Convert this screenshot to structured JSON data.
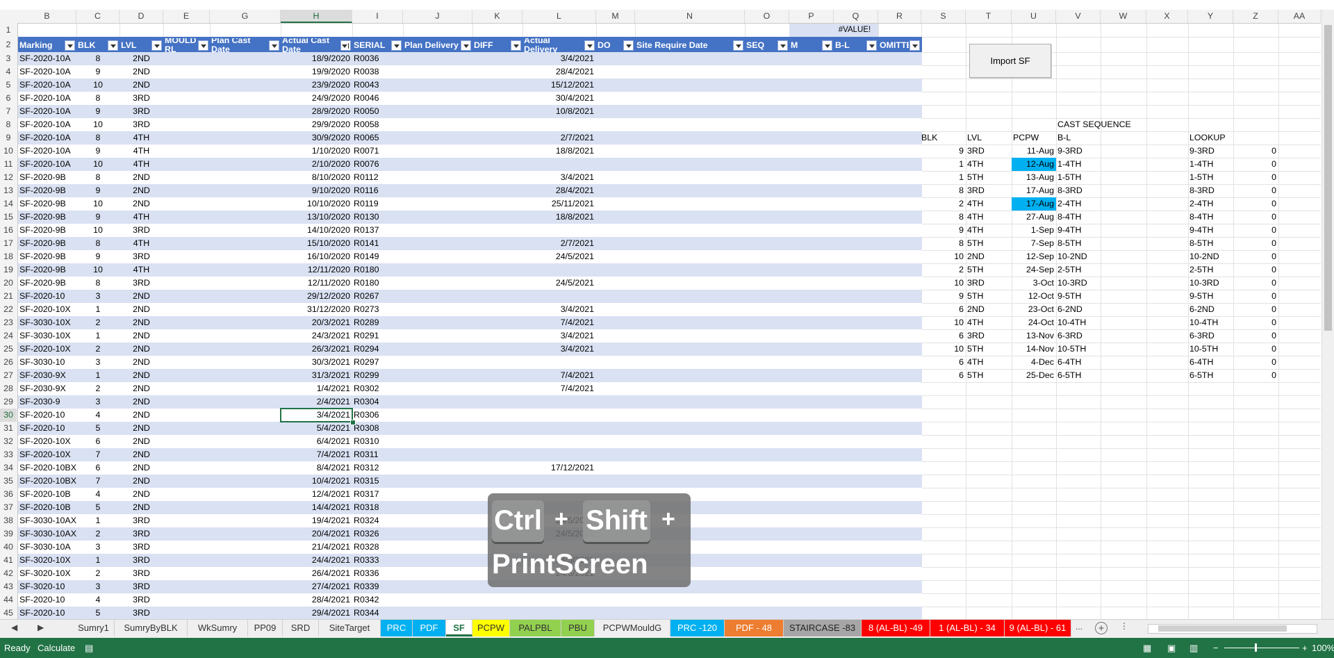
{
  "columns": [
    "B",
    "C",
    "D",
    "E",
    "G",
    "H",
    "I",
    "J",
    "K",
    "L",
    "M",
    "N",
    "O",
    "P",
    "Q",
    "R",
    "S",
    "T",
    "U",
    "V",
    "W",
    "X",
    "Y",
    "Z",
    "AA"
  ],
  "selected_column": "H",
  "row_numbers": [
    "1",
    "2",
    "3",
    "4",
    "5",
    "6",
    "7",
    "8",
    "9",
    "10",
    "11",
    "12",
    "13",
    "14",
    "15",
    "16",
    "17",
    "18",
    "19",
    "20",
    "21",
    "22",
    "23",
    "24",
    "25",
    "26",
    "27",
    "28",
    "29",
    "30",
    "31",
    "32",
    "33",
    "34",
    "35",
    "36",
    "37",
    "38",
    "39",
    "40",
    "41",
    "42",
    "43",
    "44",
    "45"
  ],
  "selected_row": "30",
  "error_cell": "#VALUE!",
  "table": {
    "headers": [
      "Marking",
      "BLK",
      "LVL",
      "MOULD RL",
      "Plan Cast Date",
      "Actual Cast Date",
      "SERIAL",
      "Plan Delivery",
      "DIFF",
      "Actual Delivery",
      "DO",
      "Site Require Date",
      "SEQ",
      "M",
      "B-L",
      "OMITTED"
    ],
    "header_colors": {
      "header_bg": "#4472c4",
      "band_bg": "#d9e1f2",
      "white_bg": "#ffffff"
    },
    "rows": [
      [
        "SF-2020-10A",
        "8",
        "2ND",
        "18/9/2020",
        "R0036",
        "3/4/2021"
      ],
      [
        "SF-2020-10A",
        "9",
        "2ND",
        "19/9/2020",
        "R0038",
        "28/4/2021"
      ],
      [
        "SF-2020-10A",
        "10",
        "2ND",
        "23/9/2020",
        "R0043",
        "15/12/2021"
      ],
      [
        "SF-2020-10A",
        "8",
        "3RD",
        "24/9/2020",
        "R0046",
        "30/4/2021"
      ],
      [
        "SF-2020-10A",
        "9",
        "3RD",
        "28/9/2020",
        "R0050",
        "10/8/2021"
      ],
      [
        "SF-2020-10A",
        "10",
        "3RD",
        "29/9/2020",
        "R0058",
        ""
      ],
      [
        "SF-2020-10A",
        "8",
        "4TH",
        "30/9/2020",
        "R0065",
        "2/7/2021"
      ],
      [
        "SF-2020-10A",
        "9",
        "4TH",
        "1/10/2020",
        "R0071",
        "18/8/2021"
      ],
      [
        "SF-2020-10A",
        "10",
        "4TH",
        "2/10/2020",
        "R0076",
        ""
      ],
      [
        "SF-2020-9B",
        "8",
        "2ND",
        "8/10/2020",
        "R0112",
        "3/4/2021"
      ],
      [
        "SF-2020-9B",
        "9",
        "2ND",
        "9/10/2020",
        "R0116",
        "28/4/2021"
      ],
      [
        "SF-2020-9B",
        "10",
        "2ND",
        "10/10/2020",
        "R0119",
        "25/11/2021"
      ],
      [
        "SF-2020-9B",
        "9",
        "4TH",
        "13/10/2020",
        "R0130",
        "18/8/2021"
      ],
      [
        "SF-2020-9B",
        "10",
        "3RD",
        "14/10/2020",
        "R0137",
        ""
      ],
      [
        "SF-2020-9B",
        "8",
        "4TH",
        "15/10/2020",
        "R0141",
        "2/7/2021"
      ],
      [
        "SF-2020-9B",
        "9",
        "3RD",
        "16/10/2020",
        "R0149",
        "24/5/2021"
      ],
      [
        "SF-2020-9B",
        "10",
        "4TH",
        "12/11/2020",
        "R0180",
        ""
      ],
      [
        "SF-2020-9B",
        "8",
        "3RD",
        "12/11/2020",
        "R0180",
        "24/5/2021"
      ],
      [
        "SF-2020-10",
        "3",
        "2ND",
        "29/12/2020",
        "R0267",
        ""
      ],
      [
        "SF-2020-10X",
        "1",
        "2ND",
        "31/12/2020",
        "R0273",
        "3/4/2021"
      ],
      [
        "SF-3030-10X",
        "2",
        "2ND",
        "20/3/2021",
        "R0289",
        "7/4/2021"
      ],
      [
        "SF-3030-10X",
        "1",
        "2ND",
        "24/3/2021",
        "R0291",
        "3/4/2021"
      ],
      [
        "SF-2020-10X",
        "2",
        "2ND",
        "26/3/2021",
        "R0294",
        "3/4/2021"
      ],
      [
        "SF-3030-10",
        "3",
        "2ND",
        "30/3/2021",
        "R0297",
        ""
      ],
      [
        "SF-2030-9X",
        "1",
        "2ND",
        "31/3/2021",
        "R0299",
        "7/4/2021"
      ],
      [
        "SF-2030-9X",
        "2",
        "2ND",
        "1/4/2021",
        "R0302",
        "7/4/2021"
      ],
      [
        "SF-2030-9",
        "3",
        "2ND",
        "2/4/2021",
        "R0304",
        ""
      ],
      [
        "SF-2020-10",
        "4",
        "2ND",
        "3/4/2021",
        "R0306",
        ""
      ],
      [
        "SF-2020-10",
        "5",
        "2ND",
        "5/4/2021",
        "R0308",
        ""
      ],
      [
        "SF-2020-10X",
        "6",
        "2ND",
        "6/4/2021",
        "R0310",
        ""
      ],
      [
        "SF-2020-10X",
        "7",
        "2ND",
        "7/4/2021",
        "R0311",
        ""
      ],
      [
        "SF-2020-10BX",
        "6",
        "2ND",
        "8/4/2021",
        "R0312",
        "17/12/2021"
      ],
      [
        "SF-2020-10BX",
        "7",
        "2ND",
        "10/4/2021",
        "R0315",
        ""
      ],
      [
        "SF-2020-10B",
        "4",
        "2ND",
        "12/4/2021",
        "R0317",
        ""
      ],
      [
        "SF-2020-10B",
        "5",
        "2ND",
        "14/4/2021",
        "R0318",
        ""
      ],
      [
        "SF-3030-10AX",
        "1",
        "3RD",
        "19/4/2021",
        "R0324",
        "24/5/2021"
      ],
      [
        "SF-3030-10AX",
        "2",
        "3RD",
        "20/4/2021",
        "R0326",
        "24/5/2021"
      ],
      [
        "SF-3030-10A",
        "3",
        "3RD",
        "21/4/2021",
        "R0328",
        ""
      ],
      [
        "SF-3020-10X",
        "1",
        "3RD",
        "24/4/2021",
        "R0333",
        "24/5/2021"
      ],
      [
        "SF-3020-10X",
        "2",
        "3RD",
        "26/4/2021",
        "R0336",
        "24/5/2021"
      ],
      [
        "SF-3020-10",
        "3",
        "3RD",
        "27/4/2021",
        "R0339",
        ""
      ],
      [
        "SF-2020-10",
        "4",
        "3RD",
        "28/4/2021",
        "R0342",
        ""
      ],
      [
        "SF-2020-10",
        "5",
        "3RD",
        "29/4/2021",
        "R0344",
        ""
      ]
    ]
  },
  "import_button_label": "Import SF",
  "cast_sequence": {
    "title": "CAST SEQUENCE",
    "headers": [
      "BLK",
      "LVL",
      "PCPW",
      "B-L",
      "LOOKUP"
    ],
    "highlight_color": "#00b0f0",
    "rows": [
      [
        "9",
        "3RD",
        "11-Aug",
        "9-3RD",
        "9-3RD",
        "0"
      ],
      [
        "1",
        "4TH",
        "12-Aug",
        "1-4TH",
        "1-4TH",
        "0"
      ],
      [
        "1",
        "5TH",
        "13-Aug",
        "1-5TH",
        "1-5TH",
        "0"
      ],
      [
        "8",
        "3RD",
        "17-Aug",
        "8-3RD",
        "8-3RD",
        "0"
      ],
      [
        "2",
        "4TH",
        "17-Aug",
        "2-4TH",
        "2-4TH",
        "0"
      ],
      [
        "8",
        "4TH",
        "27-Aug",
        "8-4TH",
        "8-4TH",
        "0"
      ],
      [
        "9",
        "4TH",
        "1-Sep",
        "9-4TH",
        "9-4TH",
        "0"
      ],
      [
        "8",
        "5TH",
        "7-Sep",
        "8-5TH",
        "8-5TH",
        "0"
      ],
      [
        "10",
        "2ND",
        "12-Sep",
        "10-2ND",
        "10-2ND",
        "0"
      ],
      [
        "2",
        "5TH",
        "24-Sep",
        "2-5TH",
        "2-5TH",
        "0"
      ],
      [
        "10",
        "3RD",
        "3-Oct",
        "10-3RD",
        "10-3RD",
        "0"
      ],
      [
        "9",
        "5TH",
        "12-Oct",
        "9-5TH",
        "9-5TH",
        "0"
      ],
      [
        "6",
        "2ND",
        "23-Oct",
        "6-2ND",
        "6-2ND",
        "0"
      ],
      [
        "10",
        "4TH",
        "24-Oct",
        "10-4TH",
        "10-4TH",
        "0"
      ],
      [
        "6",
        "3RD",
        "13-Nov",
        "6-3RD",
        "6-3RD",
        "0"
      ],
      [
        "10",
        "5TH",
        "14-Nov",
        "10-5TH",
        "10-5TH",
        "0"
      ],
      [
        "6",
        "4TH",
        "4-Dec",
        "6-4TH",
        "6-4TH",
        "0"
      ],
      [
        "6",
        "5TH",
        "25-Dec",
        "6-5TH",
        "6-5TH",
        "0"
      ]
    ],
    "highlighted_rows": [
      1,
      4
    ]
  },
  "overlay": {
    "key1": "Ctrl",
    "plus1": "+",
    "key2": "Shift",
    "plus2": "+",
    "key3": "PrintScreen"
  },
  "sheet_tabs": [
    {
      "label": "Sumry1",
      "color": ""
    },
    {
      "label": "SumryByBLK",
      "color": ""
    },
    {
      "label": "WkSumry",
      "color": ""
    },
    {
      "label": "PP09",
      "color": ""
    },
    {
      "label": "SRD",
      "color": ""
    },
    {
      "label": "SiteTarget",
      "color": ""
    },
    {
      "label": "PRC",
      "color": "#00b0f0"
    },
    {
      "label": "PDF",
      "color": "#00b0f0"
    },
    {
      "label": "SF",
      "color": "",
      "active": true
    },
    {
      "label": "PCPW",
      "color": "#ffff00"
    },
    {
      "label": "PALPBL",
      "color": "#92d050"
    },
    {
      "label": "PBU",
      "color": "#92d050"
    },
    {
      "label": "PCPWMouldG",
      "color": ""
    },
    {
      "label": "PRC -120",
      "color": "#00b0f0"
    },
    {
      "label": "PDF - 48",
      "color": "#ed7d31"
    },
    {
      "label": "STAIRCASE -83",
      "color": "#a6a6a6"
    },
    {
      "label": "8 (AL-BL) -49",
      "color": "#ff0000"
    },
    {
      "label": "1 (AL-BL) - 34",
      "color": "#ff0000"
    },
    {
      "label": "9 (AL-BL) - 61",
      "color": "#ff0000"
    }
  ],
  "tab_more": "...",
  "status": {
    "ready": "Ready",
    "calculate": "Calculate",
    "zoom": "100%"
  }
}
